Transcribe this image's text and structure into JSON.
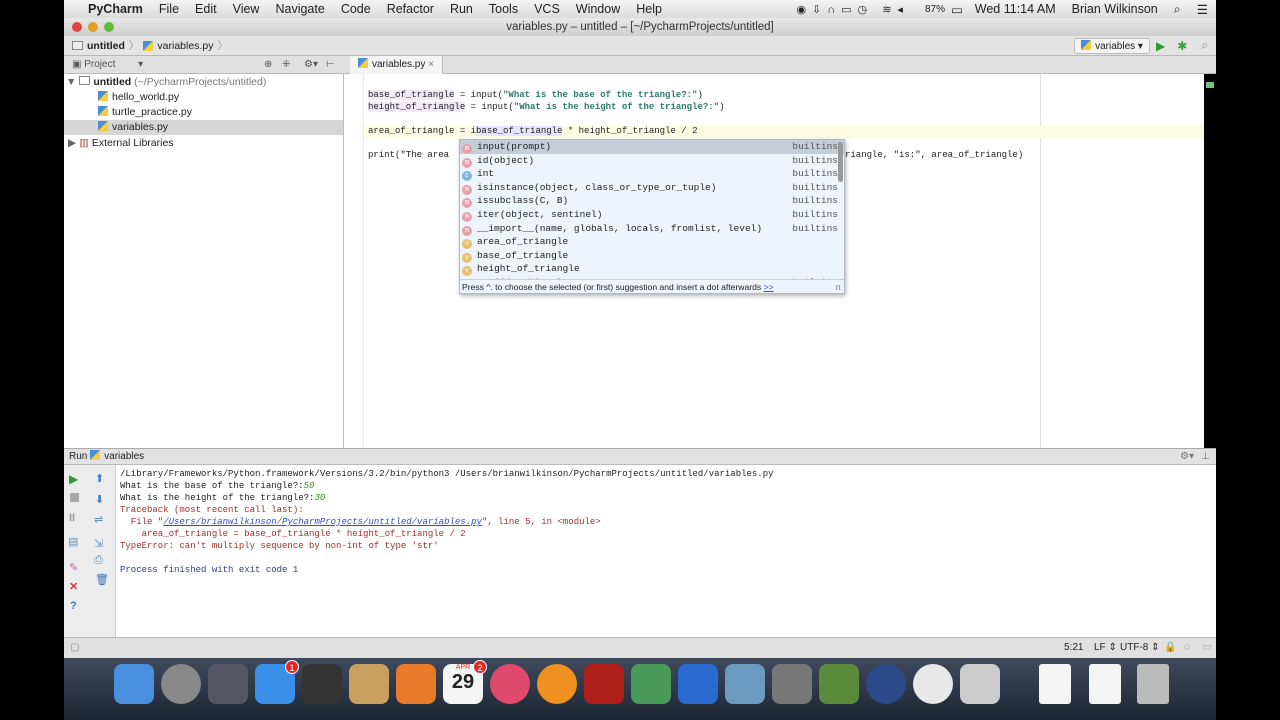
{
  "menubar": {
    "app": "PyCharm",
    "items": [
      "File",
      "Edit",
      "View",
      "Navigate",
      "Code",
      "Refactor",
      "Run",
      "Tools",
      "VCS",
      "Window",
      "Help"
    ],
    "battery": "87%",
    "clock": "Wed 11:14 AM",
    "user": "Brian Wilkinson"
  },
  "window": {
    "title": "variables.py – untitled – [~/PycharmProjects/untitled]"
  },
  "navbar": {
    "crumbs": [
      "untitled",
      "variables.py"
    ],
    "run_config": "variables"
  },
  "project": {
    "header": "Project",
    "root": "untitled",
    "root_path": "(~/PycharmProjects/untitled)",
    "files": [
      "hello_world.py",
      "turtle_practice.py",
      "variables.py"
    ],
    "selected": "variables.py",
    "external": "External Libraries"
  },
  "editor": {
    "tab": "variables.py",
    "line1": {
      "v": "base_of_triangle",
      "op": " = input(",
      "s": "\"What is the base of the triangle?:\"",
      "e": ")"
    },
    "line2": {
      "v": "height_of_triangle",
      "op": " = input(",
      "s": "\"What is the height of the triangle?:\"",
      "e": ")"
    },
    "line3": {
      "a": "area_of_triangle = i",
      "b": "base_of_triangle",
      "c": " * height_of_triangle / 2"
    },
    "line4a": "print(\"The area ",
    "line4b": "riangle, \"is:\", area_of_triangle)"
  },
  "completion": {
    "items": [
      {
        "kind": "m",
        "name": "input",
        "sig": "(prompt)",
        "src": "builtins"
      },
      {
        "kind": "m",
        "name": "id",
        "sig": "(object)",
        "src": "builtins"
      },
      {
        "kind": "c",
        "name": "int",
        "sig": "",
        "src": "builtins"
      },
      {
        "kind": "m",
        "name": "isinstance",
        "sig": "(object, class_or_type_or_tuple)",
        "src": "builtins"
      },
      {
        "kind": "m",
        "name": "issubclass",
        "sig": "(C, B)",
        "src": "builtins"
      },
      {
        "kind": "m",
        "name": "iter",
        "sig": "(object, sentinel)",
        "src": "builtins"
      },
      {
        "kind": "m",
        "name": "__import__",
        "sig": "(name, globals, locals, fromlist, level)",
        "src": "builtins"
      },
      {
        "kind": "v",
        "name": "area_of_triangle",
        "sig": "",
        "src": ""
      },
      {
        "kind": "v",
        "name": "base_of_triangle",
        "sig": "",
        "src": ""
      },
      {
        "kind": "v",
        "name": "height_of_triangle",
        "sig": "",
        "src": ""
      },
      {
        "kind": "m",
        "name": "ascii",
        "sig": "(p_object)",
        "src": "builtins"
      }
    ],
    "hint": "Press ^. to choose the selected (or first) suggestion and insert a dot afterwards",
    "hint_link": ">>",
    "pi": "π"
  },
  "run": {
    "label": "Run",
    "config": "variables",
    "lines": {
      "cmd": "/Library/Frameworks/Python.framework/Versions/3.2/bin/python3 /Users/brianwilkinson/PycharmProjects/untitled/variables.py",
      "q1": "What is the base of the triangle?:",
      "a1": "50",
      "q2": "What is the height of the triangle?:",
      "a2": "30",
      "tb": "Traceback (most recent call last):",
      "file_pre": "  File \"",
      "file_link": "/Users/brianwilkinson/PycharmProjects/untitled/variables.py",
      "file_post": "\", line 5, in <module>",
      "code": "    area_of_triangle = base_of_triangle * height_of_triangle / 2",
      "err": "TypeError: can't multiply sequence by non-int of type 'str'",
      "exit": "Process finished with exit code 1"
    }
  },
  "status": {
    "pos": "5:21",
    "line_sep": "LF",
    "encoding": "UTF-8"
  },
  "dock": {
    "badges": {
      "appstore": "1",
      "calendar": "2"
    },
    "calendar_day": "29",
    "calendar_month": "APR"
  },
  "colors": {
    "accent": "#3d7bd9",
    "error": "#a0302a",
    "link": "#2a4fd0",
    "input": "#3a8a2a"
  }
}
